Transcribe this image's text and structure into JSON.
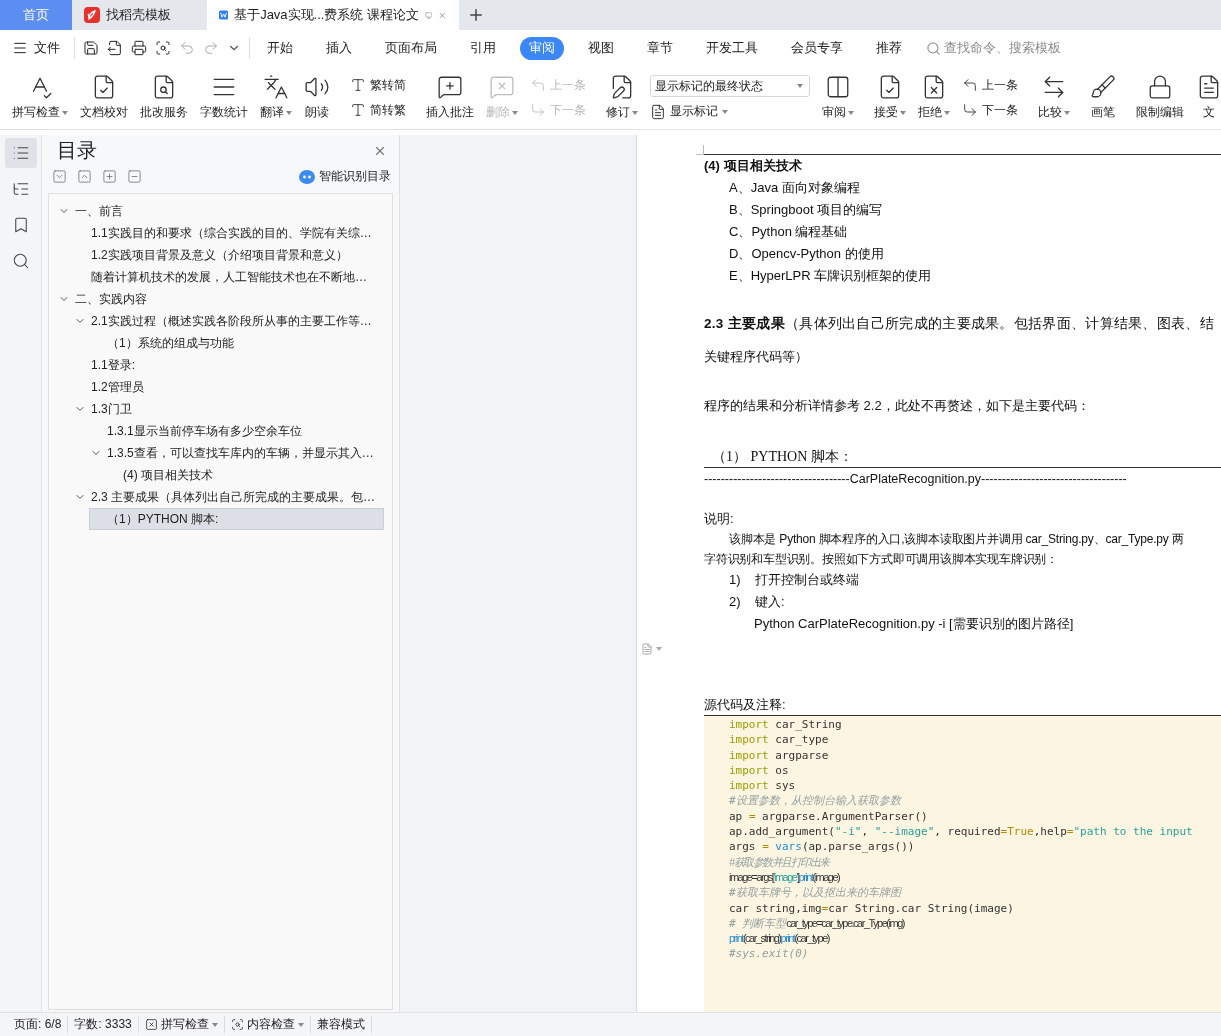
{
  "browser_tabs": [
    {
      "kind": "home",
      "label": "首页",
      "selected": false
    },
    {
      "kind": "template",
      "label": "找稻壳模板",
      "selected": false
    },
    {
      "kind": "document",
      "label": "基于Java实现...费系统 课程论文",
      "selected": true
    }
  ],
  "menu": {
    "file_label": "文件",
    "tabs": [
      {
        "label": "开始",
        "selected": false
      },
      {
        "label": "插入",
        "selected": false
      },
      {
        "label": "页面布局",
        "selected": false
      },
      {
        "label": "引用",
        "selected": false
      },
      {
        "label": "审阅",
        "selected": true
      },
      {
        "label": "视图",
        "selected": false
      },
      {
        "label": "章节",
        "selected": false
      },
      {
        "label": "开发工具",
        "selected": false
      },
      {
        "label": "会员专享",
        "selected": false
      },
      {
        "label": "推荐",
        "selected": false
      }
    ],
    "search": {
      "placeholder": "查找命令、搜索模板"
    }
  },
  "ribbon": [
    {
      "kind": "big",
      "label": "拼写检查",
      "dropdown": true,
      "disabled": false
    },
    {
      "kind": "big",
      "label": "文档校对",
      "dropdown": false,
      "disabled": false
    },
    {
      "kind": "big",
      "label": "批改服务",
      "dropdown": false,
      "disabled": false
    },
    {
      "kind": "big",
      "label": "字数统计",
      "dropdown": false,
      "disabled": false
    },
    {
      "kind": "big",
      "label": "翻译",
      "dropdown": true,
      "disabled": false
    },
    {
      "kind": "big",
      "label": "朗读",
      "dropdown": false,
      "disabled": false
    },
    {
      "kind": "separator"
    },
    {
      "kind": "pair",
      "items": [
        {
          "label": "繁转简",
          "disabled": false
        },
        {
          "label": "简转繁",
          "disabled": false
        }
      ]
    },
    {
      "kind": "separator"
    },
    {
      "kind": "big",
      "label": "插入批注",
      "dropdown": false,
      "disabled": false
    },
    {
      "kind": "big",
      "label": "删除",
      "dropdown": true,
      "disabled": true
    },
    {
      "kind": "pair",
      "items": [
        {
          "label": "上一条",
          "disabled": true
        },
        {
          "label": "下一条",
          "disabled": true
        }
      ]
    },
    {
      "kind": "separator"
    },
    {
      "kind": "big",
      "label": "修订",
      "dropdown": true,
      "disabled": false
    },
    {
      "kind": "markup",
      "select": {
        "value": "显示标记的最终状态"
      },
      "button": {
        "label": "显示标记",
        "dropdown": true
      }
    },
    {
      "kind": "big",
      "label": "审阅",
      "dropdown": true,
      "disabled": false
    },
    {
      "kind": "separator"
    },
    {
      "kind": "big",
      "label": "接受",
      "dropdown": true,
      "disabled": false
    },
    {
      "kind": "big",
      "label": "拒绝",
      "dropdown": true,
      "disabled": false
    },
    {
      "kind": "pair",
      "items": [
        {
          "label": "上一条",
          "disabled": false
        },
        {
          "label": "下一条",
          "disabled": false
        }
      ]
    },
    {
      "kind": "separator"
    },
    {
      "kind": "big",
      "label": "比较",
      "dropdown": true,
      "disabled": false
    },
    {
      "kind": "separator"
    },
    {
      "kind": "big",
      "label": "画笔",
      "dropdown": false,
      "disabled": false
    },
    {
      "kind": "separator"
    },
    {
      "kind": "big",
      "label": "限制编辑",
      "dropdown": false,
      "disabled": false
    },
    {
      "kind": "big",
      "label": "文",
      "dropdown": false,
      "disabled": false
    }
  ],
  "side_strip": [
    {
      "selected": true
    },
    {
      "selected": false
    },
    {
      "selected": false
    },
    {
      "selected": false
    }
  ],
  "outline": {
    "title": "目录",
    "smart_label": "智能识别目录",
    "items": [
      {
        "label": "一、前言",
        "selected": false,
        "expanded": true,
        "children": [
          {
            "label": "1.1实践目的和要求（综合实践的目的、学院有关综…",
            "selected": false
          },
          {
            "label": "1.2实践项目背景及意义（介绍项目背景和意义）",
            "selected": false
          },
          {
            "label": "随着计算机技术的发展，人工智能技术也在不断地…",
            "selected": false
          }
        ]
      },
      {
        "label": "二、实践内容",
        "selected": false,
        "expanded": true,
        "children": [
          {
            "label": "2.1实践过程（概述实践各阶段所从事的主要工作等…",
            "selected": false,
            "expanded": true,
            "children": [
              {
                "label": "（1）系统的组成与功能",
                "selected": false
              }
            ]
          },
          {
            "label": "1.1登录:",
            "selected": false
          },
          {
            "label": "1.2管理员",
            "selected": false
          },
          {
            "label": "1.3门卫",
            "selected": false,
            "expanded": true,
            "children": [
              {
                "label": "1.3.1显示当前停车场有多少空余车位",
                "selected": false
              },
              {
                "label": "1.3.5查看，可以查找车库内的车辆，并显示其入…",
                "selected": false,
                "expanded": true,
                "children": [
                  {
                    "label": "(4) 项目相关技术",
                    "selected": false
                  }
                ]
              }
            ]
          },
          {
            "label": "2.3 主要成果（具体列出自己所完成的主要成果。包…",
            "selected": false,
            "expanded": true,
            "children": [
              {
                "label": "（1）PYTHON 脚本:",
                "selected": true
              }
            ]
          }
        ]
      }
    ]
  },
  "document": {
    "heading": "(4) 项目相关技术",
    "tech_list": [
      "A、Java 面向对象编程",
      "B、Springboot 项目的编写",
      "C、Python 编程基础",
      "D、Opencv-Python 的使用",
      "E、HyperLPR 车牌识别框架的使用"
    ],
    "section_line1": "**2.3 主要成果**（具体列出自己所完成的主要成果。包括界面、计算结果、图表、结",
    "section_line2": "关键程序代码等）",
    "intro": "程序的结果和分析详情参考 2.2，此处不再赘述，如下是主要代码：",
    "script_heading": "（1） PYTHON 脚本：",
    "file_banner": "-----------------------------------CarPlateRecognition.py-----------------------------------",
    "note_label": "说明:",
    "note_lines": [
      "该脚本是 Python 脚本程序的入口,该脚本读取图片并调用 car_String.py、car_Type.py 两",
      "字符识别和车型识别。按照如下方式即可调用该脚本实现车牌识别："
    ],
    "steps": [
      {
        "number": "1)",
        "text": "打开控制台或终端"
      },
      {
        "number": "2)",
        "text": "键入:"
      }
    ],
    "command": "Python CarPlateRecognition.py -i [需要识别的图片路径]",
    "source_label": "源代码及注释:",
    "code": [
      [
        {
          "kind": "keyword",
          "text": "import",
          "tight": false
        },
        {
          "kind": "plain",
          "text": " car_String",
          "tight": false
        }
      ],
      [
        {
          "kind": "keyword",
          "text": "import",
          "tight": false
        },
        {
          "kind": "plain",
          "text": " car_type",
          "tight": false
        }
      ],
      [
        {
          "kind": "keyword",
          "text": "import",
          "tight": false
        },
        {
          "kind": "plain",
          "text": " argparse",
          "tight": false
        }
      ],
      [
        {
          "kind": "keyword",
          "text": "import",
          "tight": false
        },
        {
          "kind": "plain",
          "text": " os",
          "tight": false
        }
      ],
      [
        {
          "kind": "keyword",
          "text": "import",
          "tight": false
        },
        {
          "kind": "plain",
          "text": " sys",
          "tight": false
        }
      ],
      [
        {
          "kind": "comment",
          "text": "#设置参数，从控制台输入获取参数",
          "tight": false
        }
      ],
      [
        {
          "kind": "plain",
          "text": "ap ",
          "tight": false
        },
        {
          "kind": "op",
          "text": "=",
          "tight": false
        },
        {
          "kind": "plain",
          "text": " argparse.ArgumentParser()",
          "tight": false
        }
      ],
      [
        {
          "kind": "plain",
          "text": "ap.add_argument(",
          "tight": false
        },
        {
          "kind": "string",
          "text": "\"-i\"",
          "tight": false
        },
        {
          "kind": "plain",
          "text": ", ",
          "tight": false
        },
        {
          "kind": "string",
          "text": "\"--image\"",
          "tight": false
        },
        {
          "kind": "plain",
          "text": ", required",
          "tight": false
        },
        {
          "kind": "op",
          "text": "=",
          "tight": false
        },
        {
          "kind": "literal",
          "text": "True",
          "tight": false
        },
        {
          "kind": "plain",
          "text": ",help",
          "tight": false
        },
        {
          "kind": "op",
          "text": "=",
          "tight": false
        },
        {
          "kind": "string",
          "text": "\"path to the input",
          "tight": false
        }
      ],
      [
        {
          "kind": "plain",
          "text": "args ",
          "tight": false
        },
        {
          "kind": "op",
          "text": "=",
          "tight": false
        },
        {
          "kind": "builtin",
          "text": " vars",
          "tight": false
        },
        {
          "kind": "plain",
          "text": "(ap.parse_args())",
          "tight": false
        }
      ],
      [
        {
          "kind": "comment",
          "text": "#获取参数并且打印出来",
          "tight": true
        }
      ],
      [
        {
          "kind": "plain",
          "text": "image=args[",
          "tight": true
        },
        {
          "kind": "string",
          "text": "'image'",
          "tight": true
        },
        {
          "kind": "plain",
          "text": "]",
          "tight": true
        },
        {
          "kind": "builtin",
          "text": "print",
          "tight": true
        },
        {
          "kind": "plain",
          "text": "(image)",
          "tight": true
        }
      ],
      [
        {
          "kind": "comment",
          "text": "#获取车牌号，以及抠出来的车牌图",
          "tight": false
        }
      ],
      [
        {
          "kind": "plain",
          "text": "car string,img",
          "tight": false
        },
        {
          "kind": "op",
          "text": "=",
          "tight": false
        },
        {
          "kind": "plain",
          "text": "car String.car String(image)",
          "tight": false
        }
      ],
      [
        {
          "kind": "comment",
          "text": "# 判断车型",
          "tight": false
        },
        {
          "kind": "plain",
          "text": "car_type=car_type.car_Type(img)",
          "tight": true
        }
      ],
      [
        {
          "kind": "builtin",
          "text": "print",
          "tight": true
        },
        {
          "kind": "plain",
          "text": "(car_string)",
          "tight": true
        },
        {
          "kind": "builtin",
          "text": "print",
          "tight": true
        },
        {
          "kind": "plain",
          "text": "(car_type)",
          "tight": true
        }
      ],
      [
        {
          "kind": "comment",
          "text": "#sys.exit(0)",
          "tight": false
        }
      ]
    ]
  },
  "status_bar": [
    {
      "kind": "text",
      "label": "页面: 6/8"
    },
    {
      "kind": "text",
      "label": "字数: 3333"
    },
    {
      "kind": "spell",
      "label": "拼写检查"
    },
    {
      "kind": "content",
      "label": "内容检查"
    },
    {
      "kind": "text",
      "label": "兼容模式"
    }
  ]
}
